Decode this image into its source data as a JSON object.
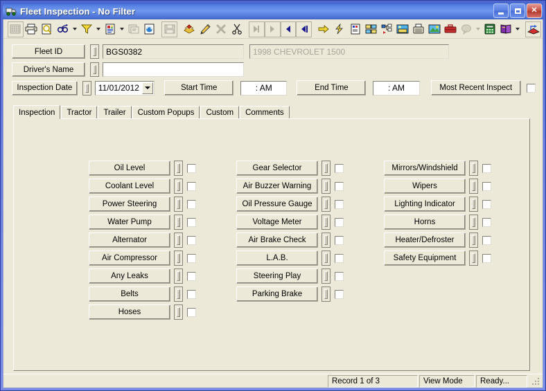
{
  "window": {
    "title": "Fleet Inspection - No Filter",
    "icon": "truck-icon",
    "minimize_label": "Minimize",
    "maximize_label": "Maximize",
    "close_label": "Close",
    "accent_title_color": "#5c86e6",
    "client_color": "#ece9d8"
  },
  "toolbar": {
    "buttons": [
      {
        "name": "grid-view-icon",
        "disabled": true
      },
      {
        "name": "print-icon",
        "disabled": false
      },
      {
        "name": "print-preview-icon",
        "disabled": false
      },
      {
        "name": "find-icon",
        "disabled": false,
        "dropdown": true
      },
      {
        "name": "filter-funnel-icon",
        "disabled": false,
        "dropdown": true
      },
      {
        "name": "report-icon",
        "disabled": false,
        "dropdown": true
      },
      {
        "name": "copy-record-icon",
        "disabled": true
      },
      {
        "name": "refresh-icon",
        "disabled": false
      },
      {
        "name": "save-icon",
        "disabled": true
      },
      {
        "name": "new-record-icon",
        "disabled": false
      },
      {
        "name": "edit-pencil-icon",
        "disabled": false
      },
      {
        "name": "delete-icon",
        "disabled": true
      },
      {
        "name": "cut-icon",
        "disabled": false
      },
      {
        "name": "first-record-icon",
        "disabled": true
      },
      {
        "name": "previous-record-icon",
        "disabled": true
      },
      {
        "name": "next-record-icon",
        "disabled": false
      },
      {
        "name": "last-record-icon",
        "disabled": false
      },
      {
        "name": "goto-icon",
        "disabled": false
      },
      {
        "name": "quick-action-icon",
        "disabled": false
      },
      {
        "name": "schedule-icon",
        "disabled": false
      },
      {
        "name": "flowchart-icon",
        "disabled": false
      },
      {
        "name": "tree-view-icon",
        "disabled": false
      },
      {
        "name": "image-icon",
        "disabled": false
      },
      {
        "name": "fax-icon",
        "disabled": false
      },
      {
        "name": "photo-icon",
        "disabled": false
      },
      {
        "name": "briefcase-icon",
        "disabled": false
      },
      {
        "name": "help-balloon-icon",
        "disabled": true,
        "dropdown": true
      },
      {
        "name": "calculator-icon",
        "disabled": false
      },
      {
        "name": "manual-book-icon",
        "disabled": false,
        "dropdown": true
      },
      {
        "name": "exit-icon",
        "disabled": false
      }
    ]
  },
  "header": {
    "fleet_id": {
      "label": "Fleet ID",
      "value": "BGS0382",
      "placeholder": ""
    },
    "vehicle_description": {
      "value": "1998 CHEVROLET 1500",
      "disabled": true
    },
    "drivers_name": {
      "label": "Driver's Name",
      "value": "",
      "placeholder": ""
    },
    "inspection_date": {
      "label": "Inspection Date",
      "value": "11/01/2012"
    },
    "start_time": {
      "label": "Start Time",
      "value": ":  AM"
    },
    "end_time": {
      "label": "End Time",
      "value": ":  AM"
    },
    "most_recent_inspect": {
      "label": "Most Recent Inspect",
      "checked": false
    }
  },
  "tabs": [
    {
      "label": "Inspection",
      "active": true
    },
    {
      "label": "Tractor",
      "active": false
    },
    {
      "label": "Trailer",
      "active": false
    },
    {
      "label": "Custom Popups",
      "active": false
    },
    {
      "label": "Custom",
      "active": false
    },
    {
      "label": "Comments",
      "active": false
    }
  ],
  "inspection": {
    "columns": [
      {
        "items": [
          {
            "label": "Oil Level",
            "checked": false
          },
          {
            "label": "Coolant Level",
            "checked": false
          },
          {
            "label": "Power Steering",
            "checked": false
          },
          {
            "label": "Water Pump",
            "checked": false
          },
          {
            "label": "Alternator",
            "checked": false
          },
          {
            "label": "Air Compressor",
            "checked": false
          },
          {
            "label": "Any Leaks",
            "checked": false
          },
          {
            "label": "Belts",
            "checked": false
          },
          {
            "label": "Hoses",
            "checked": false
          }
        ]
      },
      {
        "items": [
          {
            "label": "Gear Selector",
            "checked": false
          },
          {
            "label": "Air Buzzer Warning",
            "checked": false
          },
          {
            "label": "Oil Pressure Gauge",
            "checked": false
          },
          {
            "label": "Voltage Meter",
            "checked": false
          },
          {
            "label": "Air Brake Check",
            "checked": false
          },
          {
            "label": "L.A.B.",
            "checked": false
          },
          {
            "label": "Steering Play",
            "checked": false
          },
          {
            "label": "Parking Brake",
            "checked": false
          }
        ]
      },
      {
        "items": [
          {
            "label": "Mirrors/Windshield",
            "checked": false
          },
          {
            "label": "Wipers",
            "checked": false
          },
          {
            "label": "Lighting Indicator",
            "checked": false
          },
          {
            "label": "Horns",
            "checked": false
          },
          {
            "label": "Heater/Defroster",
            "checked": false
          },
          {
            "label": "Safety Equipment",
            "checked": false
          }
        ]
      }
    ]
  },
  "statusbar": {
    "record": "Record 1 of 3",
    "mode": "View Mode",
    "state": "Ready..."
  }
}
